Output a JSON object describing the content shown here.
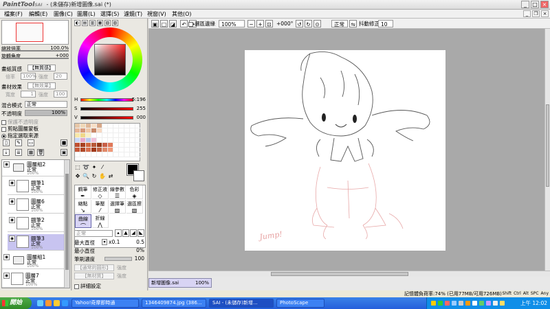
{
  "titlebar": {
    "logo": "PaintTool",
    "logo_sub": "SAI",
    "title": "- (未儲存)新增圖像.sai (*)"
  },
  "menu": [
    "檔案(F)",
    "編輯(E)",
    "圖像(C)",
    "圖層(L)",
    "選擇(S)",
    "濾鏡(T)",
    "視窗(V)",
    "其他(O)"
  ],
  "panelA": {
    "zoom_label": "縮放倍率",
    "zoom_value": "100.0%",
    "rotate_label": "旋轉角度",
    "rotate_value": "+000",
    "paper_label": "畫紙質感",
    "paper_value": "【無質感】",
    "paper_scale": "倍率",
    "paper_scale_val": "100%",
    "paper_strength": "強度",
    "paper_strength_val": "20",
    "material_label": "畫材效果",
    "material_value": "【無效果】",
    "width_label": "寬度",
    "width_val": "1",
    "strength_label": "強度",
    "strength_val": "100",
    "blend_label": "混合模式",
    "blend_value": "正常",
    "opacity_label": "不透明度",
    "opacity_value": "100%",
    "keep_opacity": "保護不透明度",
    "clip_label": "剪貼圖層蒙板",
    "select_source": "指定選取來源",
    "layers": [
      {
        "name": "圖層組2",
        "mode": "正常",
        "pct": "100%",
        "type": "folder"
      },
      {
        "name": "鋼筆1",
        "mode": "正常",
        "pct": "100%",
        "type": "pen"
      },
      {
        "name": "圖層6",
        "mode": "正常",
        "pct": "100%",
        "type": "layer"
      },
      {
        "name": "鋼筆2",
        "mode": "正常",
        "pct": "100%",
        "type": "pen"
      },
      {
        "name": "鋼筆3",
        "mode": "正常",
        "pct": "100%",
        "type": "pen"
      },
      {
        "name": "圖層組1",
        "mode": "正常",
        "pct": "100%",
        "type": "folder"
      },
      {
        "name": "圖層7",
        "mode": "正常",
        "pct": "100%",
        "type": "layer"
      }
    ]
  },
  "panelB": {
    "h_label": "H",
    "h_value": "5:196",
    "s_label": "S",
    "s_value": "255",
    "v_label": "V",
    "v_value": "000",
    "tools": [
      "鋼筆",
      "修正液",
      "線參數",
      "色彩",
      "縮點",
      "筆壓",
      "選擇筆",
      "選區擦",
      "曲線",
      "折線"
    ],
    "mode": "正常",
    "max_size_label": "最大直徑",
    "max_size_mult": "x0.1",
    "max_size_val": "0.5",
    "min_size_label": "最小直徑",
    "min_size_val": "0%",
    "density_label": "筆刷濃度",
    "density_val": "100",
    "shape_label": "【通常的圓形】",
    "shape_strength": "強度",
    "texture_label": "【無材質】",
    "texture_strength": "強度",
    "detail_label": "詳細設定"
  },
  "toolbar2": {
    "selection_edge": "選區邊緣",
    "zoom": "100%",
    "angle": "+000°",
    "mode": "正常",
    "stabilizer_label": "抖動修正",
    "stabilizer_value": "10"
  },
  "doc_tab": {
    "name": "新增圖像.sai",
    "zoom": "100%"
  },
  "status": {
    "memory": "記憶體負荷率:74% (已用77MB/可用726MB)",
    "modifiers": [
      "Shift",
      "Ctrl",
      "Alt",
      "SPC",
      "Any"
    ]
  },
  "taskbar": {
    "start": "開始",
    "tasks": [
      "Yahoo!奇摩即時通",
      "1346409874.jpg (386...",
      "SAI - (未儲存)新增...",
      "PhotoScape"
    ],
    "clock": "上午 12:02"
  },
  "colors": {
    "accent": "#c8c4f0",
    "taskbar": "#245edb",
    "canvas_bg": "#a9a9a9"
  }
}
